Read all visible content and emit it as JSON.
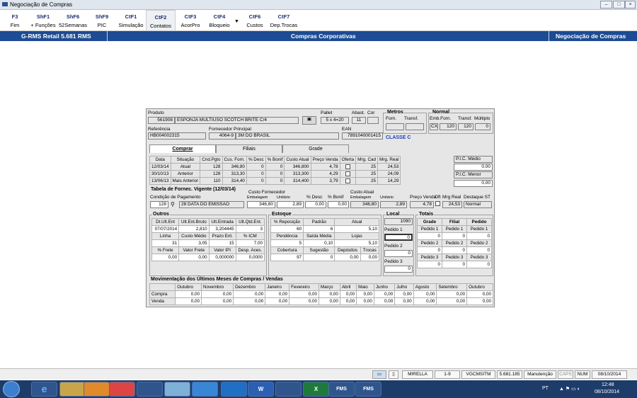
{
  "window": {
    "title": "Negociação de Compras",
    "title_suffix": "-"
  },
  "toolbar": [
    {
      "key": "F3",
      "label": "Fim"
    },
    {
      "key": "ShF1",
      "label": "+ Funções"
    },
    {
      "key": "ShF6",
      "label": "52Semanas"
    },
    {
      "key": "ShF9",
      "label": "PIC"
    },
    {
      "key": "CtF1",
      "label": "Simulação"
    },
    {
      "key": "CtF2",
      "label": "Contatos"
    },
    {
      "key": "CtF3",
      "label": "AcorPro"
    },
    {
      "key": "CtF4",
      "label": "Bloqueio"
    },
    {
      "key": "CtF6",
      "label": "Custos"
    },
    {
      "key": "CtF7",
      "label": "Dep.Trocas"
    }
  ],
  "header": {
    "left": "G-RMS Retail 5.681 RMS",
    "center": "Compras Corporativas",
    "right": "Negociação de Compras"
  },
  "product": {
    "produto_label": "Produto",
    "produto_code": "561908",
    "produto_desc": "ESPONJA MULTIUSO SCOTCH BRITE C/4",
    "pallet_label": "Pallet",
    "pallet": "5 x 4=20",
    "abast_label": "Abast.",
    "abast": "11",
    "cor_label": "Cor",
    "cor": "",
    "referencia_label": "Referência",
    "referencia": "HB004002315",
    "fornecedor_label": "Fornecedor Principal",
    "fornecedor_code": "4064-9",
    "fornecedor_name": "3M DO BRASIL",
    "ean_label": "EAN",
    "ean": "7891040001415",
    "metros_label": "Metros",
    "forn_label": "Forn.",
    "transf_label": "Transf.",
    "normal_label": "Normal",
    "emb_forn_label": "Emb.Forn.",
    "normal_transf_label": "Transf.",
    "multiplo_label": "Múltiplo",
    "emb_unit": "CX",
    "emb_forn": "120",
    "transf": "120",
    "multiplo": "0",
    "classe": "CLASSE C"
  },
  "tabs": [
    "Comprar",
    "Filiais",
    "Grade"
  ],
  "history": {
    "headers": [
      "Data",
      "Situação",
      "Cnd.Pgto",
      "Cus. Forn.",
      "% Desc",
      "% Bonif",
      "Custo Atual",
      "Preço Venda",
      "Oferta",
      "Mrg. Cad",
      "Mrg. Real"
    ],
    "rows": [
      [
        "12/03/14",
        "Atual",
        "128",
        "346,80",
        "0",
        "0",
        "346,800",
        "4,78",
        "",
        "25",
        "24,53"
      ],
      [
        "30/10/13",
        "Anterior",
        "128",
        "313,30",
        "0",
        "0",
        "313,300",
        "4,29",
        "",
        "25",
        "24,09"
      ],
      [
        "13/06/13",
        "Mais Anterior",
        "110",
        "314,40",
        "0",
        "0",
        "314,400",
        "3,79",
        "",
        "25",
        "14,29"
      ]
    ],
    "pic_medio_label": "P.I.C. Médio",
    "pic_medio": "0.00",
    "pic_menor_label": "P.I.C. Menor",
    "pic_menor": "0.00"
  },
  "tabela": {
    "title": "Tabela de Fornec. Vigente (12/03/14)",
    "cond_label": "Condição de Pagamento",
    "cond_code": "128",
    "cond_desc": "28 DATA DO EMISSAO",
    "custo_forn_label": "Custo Fornecedor",
    "embalagem_label": "Embalagem",
    "unitario_label": "Unitário",
    "custo_emb": "346,80",
    "custo_unit": "2,89",
    "desc_label": "% Desc",
    "desc": "0,00",
    "bonif_label": "% Bonif",
    "bonif": "0,00",
    "custo_atual_label": "Custo Atual",
    "atual_emb_label": "Embalagem",
    "atual_unit_label": "Unitário",
    "atual_emb": "346,80",
    "atual_unit": "2,89",
    "preco_venda_label": "Preço Venda",
    "preco_venda": "4,78",
    "oft_label": "Oft",
    "mrg_real_label": "Mrg Real",
    "mrg_real": "24,53",
    "destaque_label": "Destaque ST",
    "destaque": "Normal"
  },
  "outros": {
    "title": "Outros",
    "h1": [
      "Dt.Ult.Ent",
      "Ult.Ent.Bruto",
      "Ult.Entrada",
      "Ult.Qtd.Ent."
    ],
    "v1": [
      "07/07/2014",
      "2,810",
      "3,204445",
      "3"
    ],
    "h2": [
      "Linha",
      "Custo Médio",
      "Prazo Ent.",
      "% ICM"
    ],
    "v2": [
      "31",
      "3,05",
      "15",
      "7,00"
    ],
    "h3": [
      "% Frete",
      "Valor Frete",
      "Valor IPI",
      "Desp. Aces."
    ],
    "v3": [
      "0,00",
      "0,00",
      "0,000000",
      "0,0000"
    ]
  },
  "estoque": {
    "title": "Estoque",
    "h1": [
      "% Reposição",
      "Padrão",
      "Atual"
    ],
    "v1": [
      "60",
      "6",
      "5,10"
    ],
    "h2": [
      "Pendência",
      "Saída Média",
      "Lojas"
    ],
    "v2": [
      "5",
      "0,10",
      "5,10"
    ],
    "h3": [
      "Cobertura",
      "Sugestão",
      "Depósitos",
      "Trocas"
    ],
    "v3": [
      "97",
      "0",
      "0,00",
      "0,00"
    ]
  },
  "local": {
    "title": "Local",
    "code": "1090",
    "pedido1_label": "Pedido 1",
    "pedido1": "0",
    "pedido2_label": "Pedido 2",
    "pedido2": "0",
    "pedido3_label": "Pedido 3",
    "pedido3": "0"
  },
  "totais": {
    "title": "Totais",
    "headers": [
      "Grade",
      "Filial",
      "Pedido"
    ],
    "labels": [
      "Pedido 1",
      "Pedido 2",
      "Pedido 3"
    ],
    "values": [
      "0",
      "0"
    ]
  },
  "movimentacao": {
    "title": "Movimentação dos Últimos Meses de Compras / Vendas",
    "months": [
      "Outubro",
      "Novembro",
      "Dezembro",
      "Janeiro",
      "Fevereiro",
      "Março",
      "Abril",
      "Maio",
      "Junho",
      "Julho",
      "Agosto",
      "Setembro",
      "Outubro"
    ],
    "rows": [
      {
        "label": "Compra",
        "values": [
          "0,00",
          "0,00",
          "0,00",
          "0,00",
          "0,00",
          "0,00",
          "0,00",
          "0,00",
          "0,00",
          "0,00",
          "0,00",
          "0,00",
          "0,00"
        ]
      },
      {
        "label": "Venda",
        "values": [
          "0,00",
          "0,00",
          "0,00",
          "0,00",
          "0,00",
          "0,00",
          "0,00",
          "0,00",
          "0,00",
          "0,00",
          "0,00",
          "0,00",
          "0,00"
        ]
      }
    ]
  },
  "statusbar": [
    "MIRELLA",
    "1-9",
    "VGCMSITM",
    "5.681.185",
    "Manutenção",
    "CAPS",
    "NUM",
    "08/10/2014"
  ],
  "taskbar": {
    "apps": [
      "e",
      "",
      "",
      "",
      "",
      "",
      "",
      "",
      "W",
      "",
      "X",
      "FMS",
      "FMS"
    ],
    "lang": "PT",
    "time": "12:48",
    "date": "08/10/2014"
  },
  "colors": {
    "header_blue": "#1d4b94",
    "taskbar": "#1e3c6a",
    "classe_blue": "#1f3fc0"
  }
}
